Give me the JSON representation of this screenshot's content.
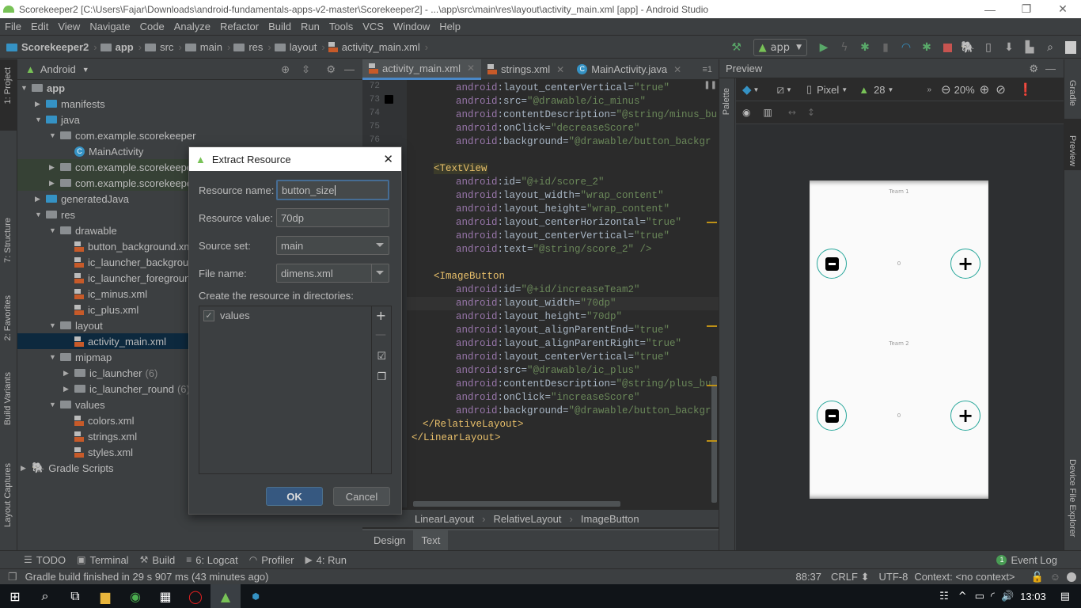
{
  "window": {
    "title": "Scorekeeper2 [C:\\Users\\Fajar\\Downloads\\android-fundamentals-apps-v2-master\\Scorekeeper2] - ...\\app\\src\\main\\res\\layout\\activity_main.xml [app] - Android Studio",
    "minimize": "—",
    "maximize": "❐",
    "close": "✕"
  },
  "menu": [
    "File",
    "Edit",
    "View",
    "Navigate",
    "Code",
    "Analyze",
    "Refactor",
    "Build",
    "Run",
    "Tools",
    "VCS",
    "Window",
    "Help"
  ],
  "breadcrumb": [
    "Scorekeeper2",
    "app",
    "src",
    "main",
    "res",
    "layout",
    "activity_main.xml"
  ],
  "toolbar": {
    "run_config": "app"
  },
  "left_strip": {
    "project": "1: Project",
    "structure": "7: Structure",
    "favorites": "2: Favorites",
    "build_variants": "Build Variants",
    "layout_captures": "Layout Captures"
  },
  "project": {
    "view_selector": "Android",
    "tree": [
      {
        "label": "app",
        "count": ""
      },
      {
        "label": "manifests",
        "count": ""
      },
      {
        "label": "java",
        "count": ""
      },
      {
        "label": "com.example.scorekeeper",
        "count": ""
      },
      {
        "label": "MainActivity",
        "count": ""
      },
      {
        "label": "com.example.scorekeeper",
        "count": ""
      },
      {
        "label": "com.example.scorekeeper",
        "count": ""
      },
      {
        "label": "generatedJava",
        "count": ""
      },
      {
        "label": "res",
        "count": ""
      },
      {
        "label": "drawable",
        "count": ""
      },
      {
        "label": "button_background.xml",
        "count": ""
      },
      {
        "label": "ic_launcher_background.xml",
        "count": ""
      },
      {
        "label": "ic_launcher_foreground.xml",
        "count": ""
      },
      {
        "label": "ic_minus.xml",
        "count": ""
      },
      {
        "label": "ic_plus.xml",
        "count": ""
      },
      {
        "label": "layout",
        "count": ""
      },
      {
        "label": "activity_main.xml",
        "count": ""
      },
      {
        "label": "mipmap",
        "count": ""
      },
      {
        "label": "ic_launcher",
        "count": "(6)"
      },
      {
        "label": "ic_launcher_round",
        "count": "(6)"
      },
      {
        "label": "values",
        "count": ""
      },
      {
        "label": "colors.xml",
        "count": ""
      },
      {
        "label": "strings.xml",
        "count": ""
      },
      {
        "label": "styles.xml",
        "count": ""
      },
      {
        "label": "Gradle Scripts",
        "count": ""
      }
    ]
  },
  "editor": {
    "tabs": [
      "activity_main.xml",
      "strings.xml",
      "MainActivity.java"
    ],
    "tab_overflow": "≡1",
    "line_numbers": [
      "72",
      "73",
      "74",
      "75",
      "76"
    ],
    "lines": [
      {
        "a": "android",
        "n": ":layout_centerVertical=",
        "v": "\"true\""
      },
      {
        "a": "android",
        "n": ":src=",
        "v": "\"@drawable/ic_minus\""
      },
      {
        "a": "android",
        "n": ":contentDescription=",
        "v": "\"@string/minus_bu"
      },
      {
        "a": "android",
        "n": ":onClick=",
        "v": "\"decreaseScore\""
      },
      {
        "a": "android",
        "n": ":background=",
        "v": "\"@drawable/button_backgr"
      },
      {
        "tag": "<TextView"
      },
      {
        "a": "android",
        "n": ":id=",
        "v": "\"@+id/score_2\""
      },
      {
        "a": "android",
        "n": ":layout_width=",
        "v": "\"wrap_content\""
      },
      {
        "a": "android",
        "n": ":layout_height=",
        "v": "\"wrap_content\""
      },
      {
        "a": "android",
        "n": ":layout_centerHorizontal=",
        "v": "\"true\""
      },
      {
        "a": "android",
        "n": ":layout_centerVertical=",
        "v": "\"true\""
      },
      {
        "a": "android",
        "n": ":text=",
        "v": "\"@string/score_2\" />"
      },
      {
        "tag": "<ImageButton"
      },
      {
        "a": "android",
        "n": ":id=",
        "v": "\"@+id/increaseTeam2\""
      },
      {
        "a": "android",
        "n": ":layout_width=",
        "v": "\"70dp\""
      },
      {
        "a": "android",
        "n": ":layout_height=",
        "v": "\"70dp\""
      },
      {
        "a": "android",
        "n": ":layout_alignParentEnd=",
        "v": "\"true\""
      },
      {
        "a": "android",
        "n": ":layout_alignParentRight=",
        "v": "\"true\""
      },
      {
        "a": "android",
        "n": ":layout_centerVertical=",
        "v": "\"true\""
      },
      {
        "a": "android",
        "n": ":src=",
        "v": "\"@drawable/ic_plus\""
      },
      {
        "a": "android",
        "n": ":contentDescription=",
        "v": "\"@string/plus_bu"
      },
      {
        "a": "android",
        "n": ":onClick=",
        "v": "\"increaseScore\""
      },
      {
        "a": "android",
        "n": ":background=",
        "v": "\"@drawable/button_backgr"
      },
      {
        "tag": "</RelativeLayout>"
      },
      {
        "tag": "</LinearLayout>"
      }
    ],
    "crumbs": [
      "LinearLayout",
      "RelativeLayout",
      "ImageButton"
    ],
    "bottom_tabs": [
      "Design",
      "Text"
    ]
  },
  "preview": {
    "title": "Preview",
    "palette": "Palette",
    "device": "Pixel",
    "api": "28",
    "zoom": "20%",
    "phone": {
      "team1": "Team 1",
      "score1": "0",
      "team2": "Team 2",
      "score2": "0"
    }
  },
  "right_strip": {
    "gradle": "Gradle",
    "preview": "Preview",
    "device_file_explorer": "Device File Explorer"
  },
  "dialog": {
    "title": "Extract Resource",
    "resource_name_label": "Resource name:",
    "resource_name_value": "button_size",
    "resource_value_label": "Resource value:",
    "resource_value": "70dp",
    "source_set_label": "Source set:",
    "source_set_value": "main",
    "file_name_label": "File name:",
    "file_name_value": "dimens.xml",
    "directories_label": "Create the resource in directories:",
    "directories": [
      {
        "label": "values",
        "checked": true
      }
    ],
    "ok": "OK",
    "cancel": "Cancel"
  },
  "bottom_tools": [
    "TODO",
    "Terminal",
    "Build",
    "6: Logcat",
    "Profiler",
    "4: Run"
  ],
  "event_log": {
    "count": "1",
    "label": "Event Log"
  },
  "status": {
    "message": "Gradle build finished in 29 s 907 ms (43 minutes ago)",
    "position": "88:37",
    "line_sep": "CRLF ⬍",
    "encoding": "UTF-8",
    "context": "Context: <no context>"
  },
  "taskbar": {
    "time": "13:03"
  },
  "colors": {
    "accent": "#4a88c7",
    "ok_button": "#365880",
    "teal": "#26a69a"
  }
}
